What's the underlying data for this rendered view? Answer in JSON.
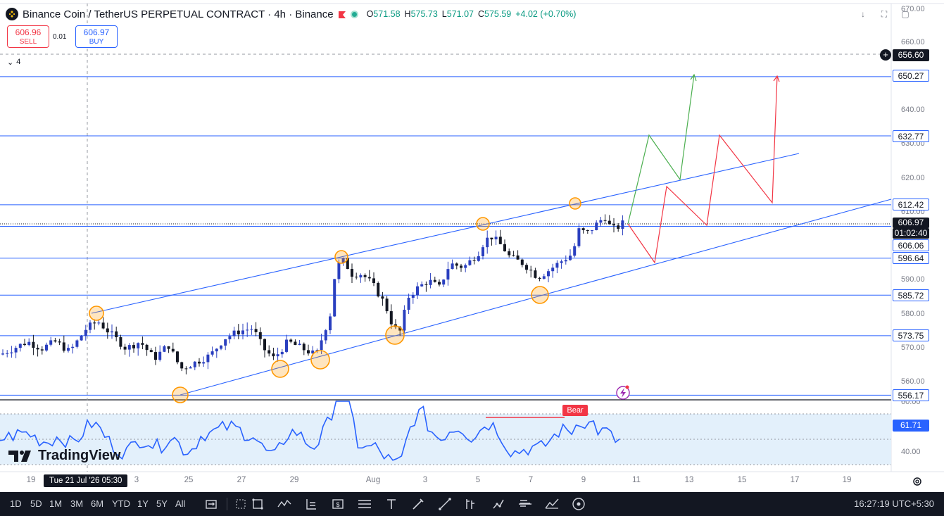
{
  "header": {
    "title": "Binance Coin / TetherUS PERPETUAL CONTRACT · 4h · Binance",
    "ohlc": {
      "o": "571.58",
      "h": "575.73",
      "l": "571.07",
      "c": "575.59",
      "change": "+4.02 (+0.70%)"
    },
    "o_label": "O",
    "h_label": "H",
    "l_label": "L",
    "c_label": "C"
  },
  "trade": {
    "sell_price": "606.96",
    "sell_label": "SELL",
    "buy_price": "606.97",
    "buy_label": "BUY",
    "spread": "0.01",
    "indicator_count": "4"
  },
  "price_axis": {
    "ticks": [
      "670.00",
      "660.00",
      "640.00",
      "630.00",
      "620.00",
      "610.00",
      "590.00",
      "580.00",
      "570.00",
      "560.00"
    ],
    "labels": {
      "crosshair": "656.60",
      "l650": "650.27",
      "l632": "632.77",
      "l612": "612.42",
      "current": "606.97",
      "countdown": "01:02:40",
      "l606": "606.06",
      "l596": "596.64",
      "l585": "585.72",
      "l573": "573.75",
      "l556": "556.17"
    },
    "rsi_ticks": [
      "60.00",
      "40.00"
    ],
    "rsi_value": "61.71"
  },
  "time_axis": {
    "ticks": [
      "19",
      "25",
      "27",
      "29",
      "Aug",
      "3",
      "5",
      "7",
      "9",
      "11",
      "13",
      "15",
      "17",
      "19"
    ],
    "crosshair_date": "Tue 21 Jul '26   05:30",
    "partial_tick": "3"
  },
  "indicator": {
    "bear_label": "Bear"
  },
  "brand": {
    "logo_text": "TradingView"
  },
  "bottom_bar": {
    "ranges": [
      "1D",
      "5D",
      "1M",
      "3M",
      "6M",
      "YTD",
      "1Y",
      "5Y",
      "All"
    ],
    "clock": "16:27:19 UTC+5:30"
  },
  "colors": {
    "up": "#2a3fbf",
    "down": "#131722",
    "line": "#2962ff",
    "green_path": "#4caf50",
    "red_path": "#f23645",
    "circle": "#ff9800",
    "rsi": "#2962ff",
    "rsi_band": "#e3f0fb"
  },
  "chart_data": {
    "type": "candlestick",
    "ylim": [
      550,
      672
    ],
    "horizontal_levels": [
      650.27,
      632.77,
      612.42,
      606.06,
      596.64,
      585.72,
      573.75,
      556.17
    ],
    "channel": {
      "upper": [
        [
          0,
          580.9
        ],
        [
          1,
          626.5
        ]
      ],
      "lower": [
        [
          0,
          556.3
        ],
        [
          1,
          613.0
        ]
      ]
    }
  }
}
